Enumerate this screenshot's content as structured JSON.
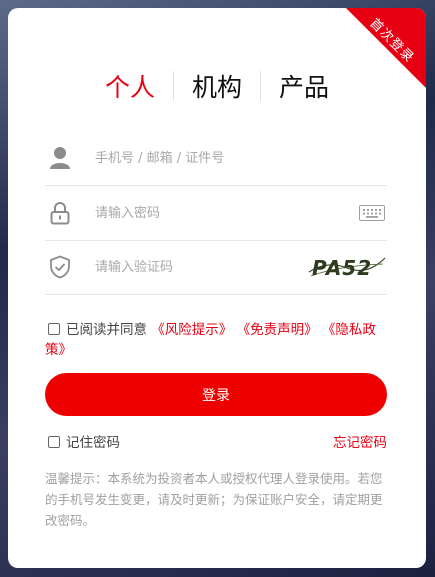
{
  "ribbon": {
    "label": "首次登录"
  },
  "tabs": [
    {
      "label": "个人",
      "active": true
    },
    {
      "label": "机构",
      "active": false
    },
    {
      "label": "产品",
      "active": false
    }
  ],
  "fields": {
    "account": {
      "placeholder": "手机号 / 邮箱 / 证件号",
      "icon": "user-icon"
    },
    "password": {
      "placeholder": "请输入密码",
      "icon": "lock-icon",
      "trailing_icon": "keyboard-icon"
    },
    "captcha": {
      "placeholder": "请输入验证码",
      "icon": "shield-icon",
      "image_text": "PA52"
    }
  },
  "agreement": {
    "prefix": "已阅读并同意",
    "risk": "《风险提示》",
    "disclaimer": "《免责声明》",
    "privacy": "《隐私政策》"
  },
  "login_button": "登录",
  "remember_label": "记住密码",
  "forgot_label": "忘记密码",
  "tip": "温馨提示：本系统为投资者本人或授权代理人登录使用。若您的手机号发生变更，请及时更新；为保证账户安全，请定期更改密码。",
  "colors": {
    "accent": "#e60012",
    "button": "#ee0000"
  }
}
